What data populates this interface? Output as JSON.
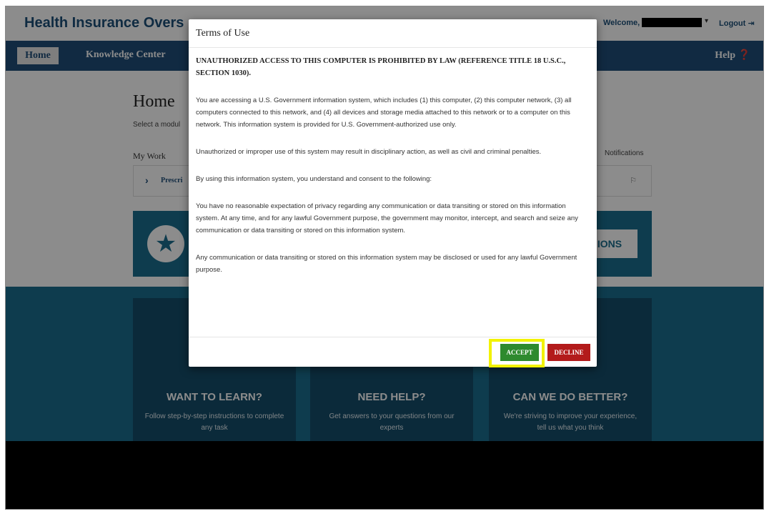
{
  "header": {
    "brand": "Health Insurance Overs",
    "welcome": "Welcome,",
    "caret": "▾",
    "logout": "Logout ⇥"
  },
  "nav": {
    "home": "Home",
    "knowledge_center": "Knowledge Center",
    "help": "Help ❓"
  },
  "main": {
    "title": "Home",
    "subtitle": "Select a modul",
    "my_work": "My Work",
    "notifications": "Notifications",
    "work_item": "Prescri",
    "banner_button": "IONS"
  },
  "cards": [
    {
      "title": "WANT TO LEARN?",
      "text": "Follow step-by-step instructions to complete any task"
    },
    {
      "title": "NEED HELP?",
      "text": "Get answers to your questions from our experts"
    },
    {
      "title": "CAN WE DO BETTER?",
      "text": "We're striving to improve your experience, tell us what you think"
    }
  ],
  "modal": {
    "title": "Terms of Use",
    "warning": "UNAUTHORIZED ACCESS TO THIS COMPUTER IS PROHIBITED BY LAW (REFERENCE TITLE 18 U.S.C., SECTION 1030).",
    "p1": "You are accessing a U.S. Government information system, which includes (1) this computer, (2) this computer network, (3) all computers connected to this network, and (4) all devices and storage media attached to this network or to a computer on this network. This information system is provided for U.S. Government-authorized use only.",
    "p2": "Unauthorized or improper use of this system may result in disciplinary action, as well as civil and criminal penalties.",
    "p3": "By using this information system, you understand and consent to the following:",
    "p4": "You have no reasonable expectation of privacy regarding any communication or data transiting or stored on this information system. At any time, and for any lawful Government purpose, the government may monitor, intercept, and search and seize any communication or data transiting or stored on this information system.",
    "p5": "Any communication or data transiting or stored on this information system may be disclosed or used for any lawful Government purpose.",
    "accept": "ACCEPT",
    "decline": "DECLINE"
  },
  "colors": {
    "navy": "#1f4e79",
    "teal": "#1a6e8e",
    "accept": "#2e8a2e",
    "decline": "#b31b1b",
    "highlight": "#f2f200"
  }
}
